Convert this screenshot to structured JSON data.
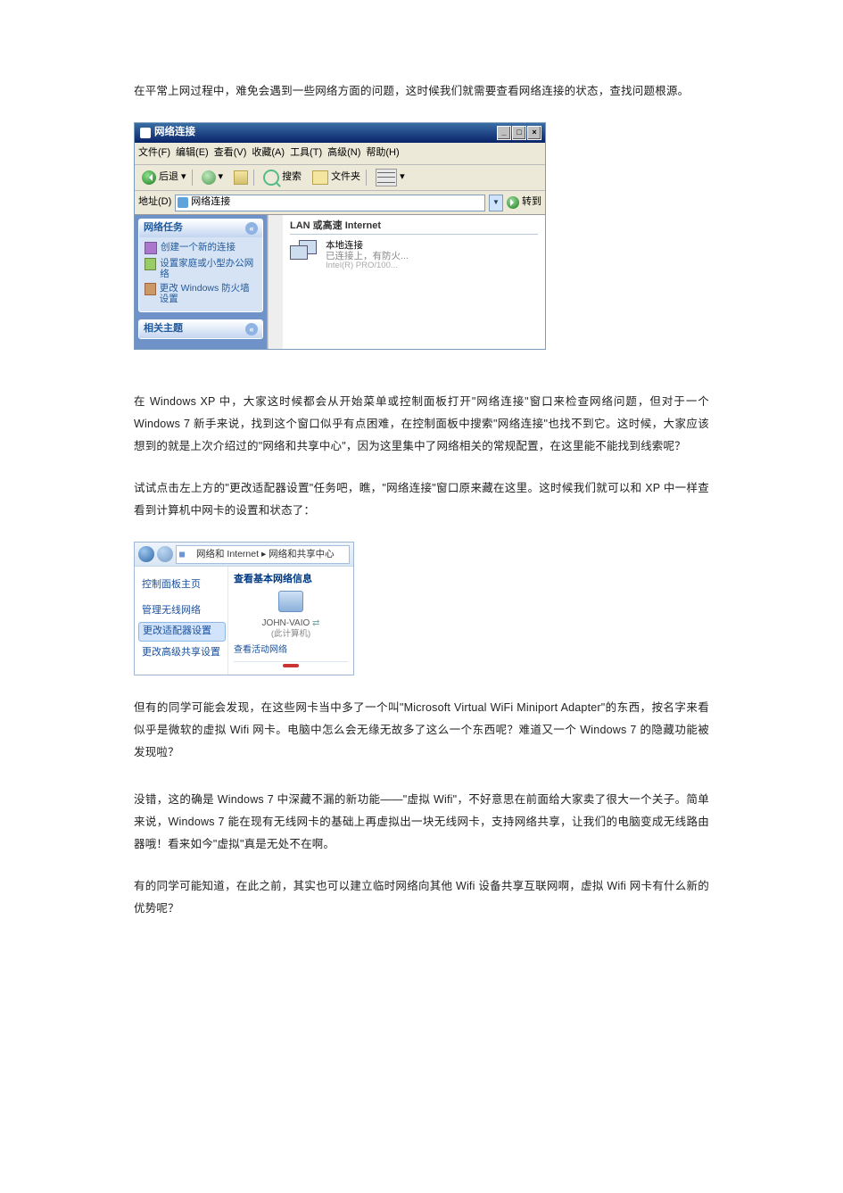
{
  "para1": "在平常上网过程中，难免会遇到一些网络方面的问题，这时候我们就需要查看网络连接的状态，查找问题根源。",
  "para2": "在 Windows XP 中，大家这时候都会从开始菜单或控制面板打开\"网络连接\"窗口来检查网络问题，但对于一个 Windows 7 新手来说，找到这个窗口似乎有点困难，在控制面板中搜索\"网络连接\"也找不到它。这时候，大家应该想到的就是上次介绍过的\"网络和共享中心\"，因为这里集中了网络相关的常规配置，在这里能不能找到线索呢？",
  "para3": "试试点击左上方的\"更改适配器设置\"任务吧，瞧，\"网络连接\"窗口原来藏在这里。这时候我们就可以和 XP 中一样查看到计算机中网卡的设置和状态了：",
  "para4": "但有的同学可能会发现，在这些网卡当中多了一个叫\"Microsoft Virtual WiFi Miniport Adapter\"的东西，按名字来看似乎是微软的虚拟 Wifi 网卡。电脑中怎么会无缘无故多了这么一个东西呢？难道又一个 Windows 7 的隐藏功能被发现啦？",
  "para5": "没错，这的确是 Windows 7 中深藏不漏的新功能——\"虚拟 Wifi\"，不好意思在前面给大家卖了很大一个关子。简单来说，Windows 7 能在现有无线网卡的基础上再虚拟出一块无线网卡，支持网络共享，让我们的电脑变成无线路由器哦！看来如今\"虚拟\"真是无处不在啊。",
  "para6": "有的同学可能知道，在此之前，其实也可以建立临时网络向其他 Wifi 设备共享互联网啊，虚拟 Wifi 网卡有什么新的优势呢？",
  "xp": {
    "title": "网络连接",
    "menu": {
      "file": "文件(F)",
      "edit": "编辑(E)",
      "view": "查看(V)",
      "fav": "收藏(A)",
      "tools": "工具(T)",
      "adv": "高级(N)",
      "help": "帮助(H)"
    },
    "toolbar": {
      "back": "后退",
      "search": "搜索",
      "folders": "文件夹"
    },
    "addr": {
      "label": "地址(D)",
      "value": "网络连接",
      "go": "转到"
    },
    "tasks_header": "网络任务",
    "task1": "创建一个新的连接",
    "task2": "设置家庭或小型办公网络",
    "task3": "更改 Windows 防火墙设置",
    "related_header": "相关主题",
    "group": "LAN 或高速 Internet",
    "conn_name": "本地连接",
    "conn_status": "已连接上，有防火...",
    "conn_adapter": "Intel(R) PRO/100..."
  },
  "w7": {
    "breadcrumb": "网络和 Internet ▸ 网络和共享中心",
    "side_home": "控制面板主页",
    "side_wlan": "管理无线网络",
    "side_adapter": "更改适配器设置",
    "side_share": "更改高级共享设置",
    "heading": "查看基本网络信息",
    "computer": "JOHN-VAIO",
    "computer_sub": "(此计算机)",
    "active": "查看活动网络"
  }
}
